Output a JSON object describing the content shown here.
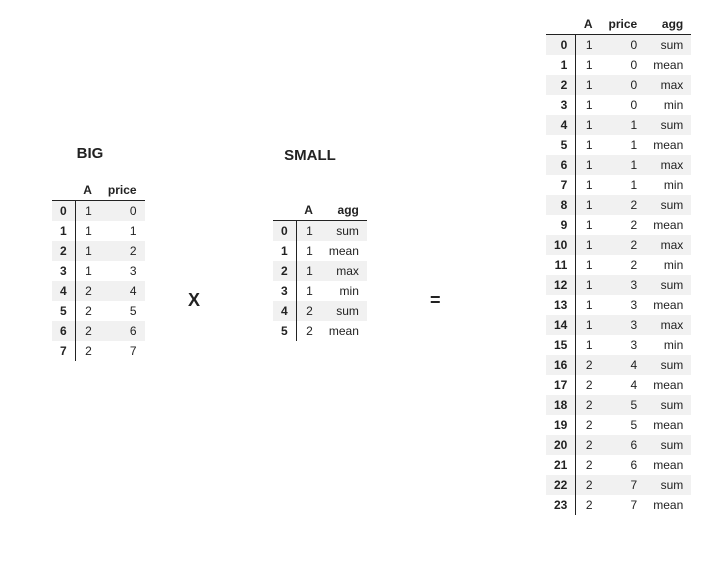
{
  "titles": {
    "big": "BIG",
    "small": "SMALL"
  },
  "operators": {
    "times": "X",
    "equals": "="
  },
  "tables": {
    "big": {
      "columns": [
        "A",
        "price"
      ],
      "rows": [
        {
          "idx": "0",
          "cells": [
            "1",
            "0"
          ]
        },
        {
          "idx": "1",
          "cells": [
            "1",
            "1"
          ]
        },
        {
          "idx": "2",
          "cells": [
            "1",
            "2"
          ]
        },
        {
          "idx": "3",
          "cells": [
            "1",
            "3"
          ]
        },
        {
          "idx": "4",
          "cells": [
            "2",
            "4"
          ]
        },
        {
          "idx": "5",
          "cells": [
            "2",
            "5"
          ]
        },
        {
          "idx": "6",
          "cells": [
            "2",
            "6"
          ]
        },
        {
          "idx": "7",
          "cells": [
            "2",
            "7"
          ]
        }
      ]
    },
    "small": {
      "columns": [
        "A",
        "agg"
      ],
      "rows": [
        {
          "idx": "0",
          "cells": [
            "1",
            "sum"
          ]
        },
        {
          "idx": "1",
          "cells": [
            "1",
            "mean"
          ]
        },
        {
          "idx": "2",
          "cells": [
            "1",
            "max"
          ]
        },
        {
          "idx": "3",
          "cells": [
            "1",
            "min"
          ]
        },
        {
          "idx": "4",
          "cells": [
            "2",
            "sum"
          ]
        },
        {
          "idx": "5",
          "cells": [
            "2",
            "mean"
          ]
        }
      ]
    },
    "result": {
      "columns": [
        "A",
        "price",
        "agg"
      ],
      "rows": [
        {
          "idx": "0",
          "cells": [
            "1",
            "0",
            "sum"
          ]
        },
        {
          "idx": "1",
          "cells": [
            "1",
            "0",
            "mean"
          ]
        },
        {
          "idx": "2",
          "cells": [
            "1",
            "0",
            "max"
          ]
        },
        {
          "idx": "3",
          "cells": [
            "1",
            "0",
            "min"
          ]
        },
        {
          "idx": "4",
          "cells": [
            "1",
            "1",
            "sum"
          ]
        },
        {
          "idx": "5",
          "cells": [
            "1",
            "1",
            "mean"
          ]
        },
        {
          "idx": "6",
          "cells": [
            "1",
            "1",
            "max"
          ]
        },
        {
          "idx": "7",
          "cells": [
            "1",
            "1",
            "min"
          ]
        },
        {
          "idx": "8",
          "cells": [
            "1",
            "2",
            "sum"
          ]
        },
        {
          "idx": "9",
          "cells": [
            "1",
            "2",
            "mean"
          ]
        },
        {
          "idx": "10",
          "cells": [
            "1",
            "2",
            "max"
          ]
        },
        {
          "idx": "11",
          "cells": [
            "1",
            "2",
            "min"
          ]
        },
        {
          "idx": "12",
          "cells": [
            "1",
            "3",
            "sum"
          ]
        },
        {
          "idx": "13",
          "cells": [
            "1",
            "3",
            "mean"
          ]
        },
        {
          "idx": "14",
          "cells": [
            "1",
            "3",
            "max"
          ]
        },
        {
          "idx": "15",
          "cells": [
            "1",
            "3",
            "min"
          ]
        },
        {
          "idx": "16",
          "cells": [
            "2",
            "4",
            "sum"
          ]
        },
        {
          "idx": "17",
          "cells": [
            "2",
            "4",
            "mean"
          ]
        },
        {
          "idx": "18",
          "cells": [
            "2",
            "5",
            "sum"
          ]
        },
        {
          "idx": "19",
          "cells": [
            "2",
            "5",
            "mean"
          ]
        },
        {
          "idx": "20",
          "cells": [
            "2",
            "6",
            "sum"
          ]
        },
        {
          "idx": "21",
          "cells": [
            "2",
            "6",
            "mean"
          ]
        },
        {
          "idx": "22",
          "cells": [
            "2",
            "7",
            "sum"
          ]
        },
        {
          "idx": "23",
          "cells": [
            "2",
            "7",
            "mean"
          ]
        }
      ]
    }
  }
}
